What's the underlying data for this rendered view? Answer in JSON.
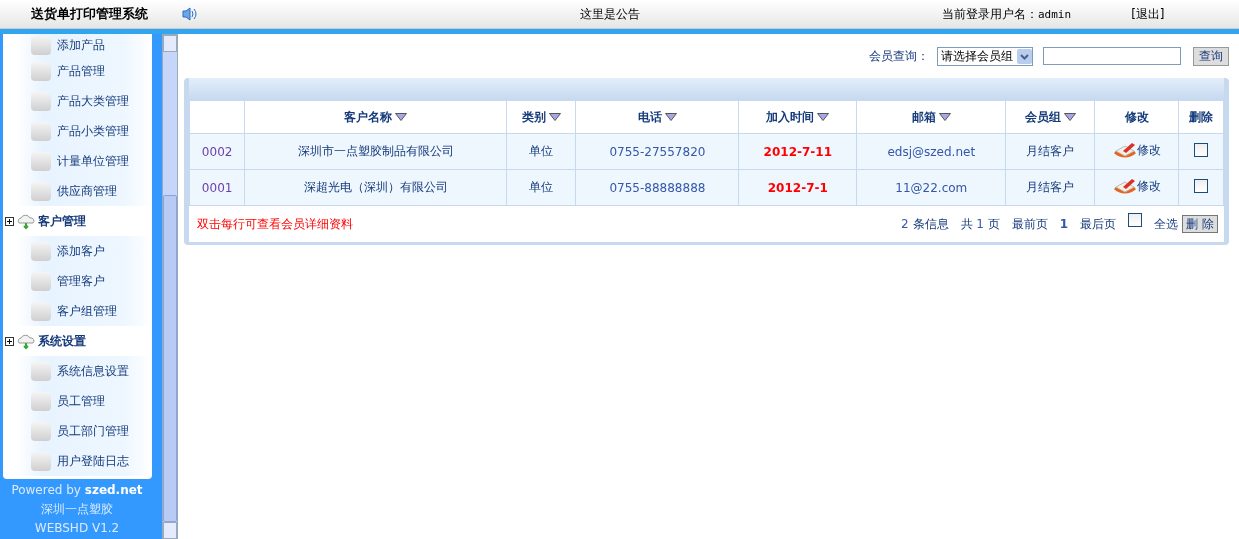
{
  "header": {
    "title": "送货单打印管理系统",
    "notice": "这里是公告",
    "user_label": "当前登录用户名：",
    "user": "admin",
    "logout": "[退出]"
  },
  "sidebar": {
    "sections": [
      {
        "items": [
          "添加产品",
          "产品管理",
          "产品大类管理",
          "产品小类管理",
          "计量单位管理",
          "供应商管理"
        ]
      },
      {
        "title": "客户管理",
        "items": [
          "添加客户",
          "管理客户",
          "客户组管理"
        ]
      },
      {
        "title": "系统设置",
        "items": [
          "系统信息设置",
          "员工管理",
          "员工部门管理",
          "用户登陆日志"
        ]
      }
    ],
    "footer": [
      "Powered by **szed.net**",
      "深圳一点塑胶",
      "WEBSHD V1.2"
    ]
  },
  "search": {
    "label": "会员查询：",
    "select": "请选择会员组",
    "button": "查询"
  },
  "table": {
    "columns": [
      {
        "sortable": false
      },
      {
        "label": "客户名称",
        "sortable": true
      },
      {
        "label": "类别",
        "sortable": true
      },
      {
        "label": "电话",
        "sortable": true
      },
      {
        "label": "加入时间",
        "sortable": true
      },
      {
        "label": "邮箱",
        "sortable": true
      },
      {
        "label": "会员组",
        "sortable": true
      },
      {
        "label": "修改",
        "sortable": false
      },
      {
        "label": "删除",
        "sortable": false
      }
    ],
    "rows": [
      {
        "code": "0002",
        "name": "深圳市一点塑胶制品有限公司",
        "type": "单位",
        "phone": "0755-27557820",
        "joined": "2012-7-11",
        "email": "edsj@szed.net",
        "group": "月结客户",
        "edit": "修改",
        "checked": false
      },
      {
        "code": "0001",
        "name": "深超光电（深圳）有限公司",
        "type": "单位",
        "phone": "0755-88888888",
        "joined": "2012-7-1",
        "email": "11@22.com",
        "group": "月结客户",
        "edit": "修改",
        "checked": false
      }
    ],
    "hint": "双击每行可查看会员详细资料",
    "pager": {
      "count": "2",
      "count_label": "条信息",
      "total_pre": "共",
      "pages": "1",
      "total_post": "页",
      "first": "最前页",
      "current": "1",
      "last": "最后页",
      "select_all": "全选",
      "select_all_checked": false,
      "delete": "删 除"
    }
  }
}
